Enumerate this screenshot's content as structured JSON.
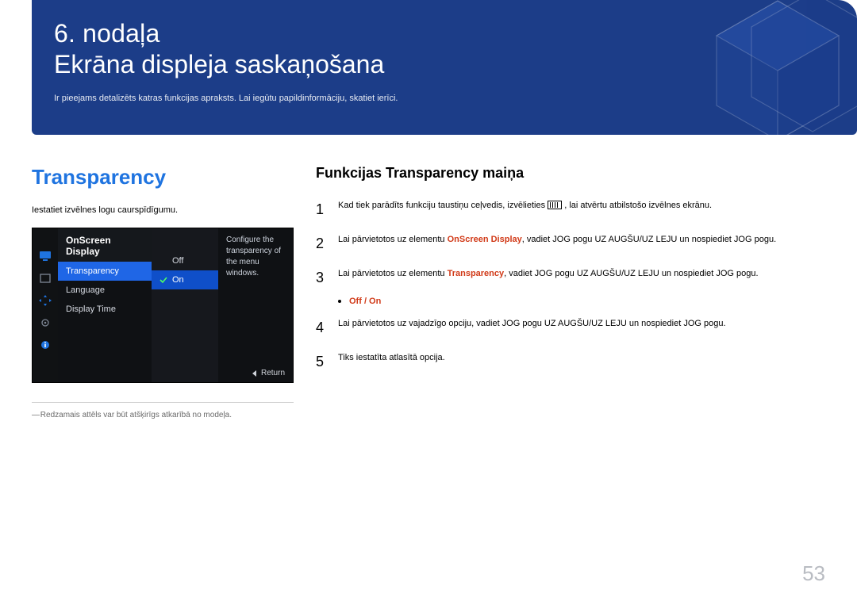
{
  "chapter": {
    "number": "6. nodaļa",
    "title": "Ekrāna displeja saskaņošana",
    "subtitle": "Ir pieejams detalizēts katras funkcijas apraksts. Lai iegūtu papildinformāciju, skatiet ierīci."
  },
  "left": {
    "section_title": "Transparency",
    "lead": "Iestatiet izvēlnes logu caurspīdīgumu.",
    "osd": {
      "panel_title": "OnScreen Display",
      "items": [
        {
          "label": "Transparency",
          "selected": true
        },
        {
          "label": "Language",
          "selected": false
        },
        {
          "label": "Display Time",
          "selected": false
        }
      ],
      "options": [
        {
          "label": "Off",
          "selected": false
        },
        {
          "label": "On",
          "selected": true
        }
      ],
      "description": "Configure the transparency of the menu windows.",
      "return_label": "Return",
      "rail_icons": [
        "monitor",
        "box",
        "arrows",
        "gear",
        "info"
      ]
    },
    "footnote": "Redzamais attēls var būt atšķirīgs atkarībā no modeļa."
  },
  "right": {
    "title": "Funkcijas Transparency maiņa",
    "steps": [
      {
        "num": "1",
        "pre": "Kad tiek parādīts funkciju taustiņu ceļvedis, izvēlieties ",
        "post": ", lai atvērtu atbilstošo izvēlnes ekrānu."
      },
      {
        "num": "2",
        "pre": "Lai pārvietotos uz elementu ",
        "hl": "OnScreen Display",
        "post": ", vadiet JOG pogu UZ AUGŠU/UZ LEJU un nospiediet JOG pogu."
      },
      {
        "num": "3",
        "pre": "Lai pārvietotos uz elementu ",
        "hl": "Transparency",
        "post": ", vadiet JOG pogu UZ AUGŠU/UZ LEJU un nospiediet JOG pogu."
      },
      {
        "num": "4",
        "text": "Lai pārvietotos uz vajadzīgo opciju, vadiet JOG pogu UZ AUGŠU/UZ LEJU un nospiediet JOG pogu."
      },
      {
        "num": "5",
        "text": "Tiks iestatīta atlasītā opcija."
      }
    ],
    "onoff": "Off / On"
  },
  "page_number": "53"
}
